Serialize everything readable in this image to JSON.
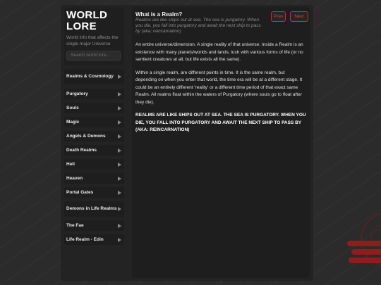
{
  "sidebar": {
    "title_line1": "WORLD",
    "title_line2": "LORE",
    "subtitle": "World info that affects the single major Universe",
    "search_placeholder": "Search world lore...",
    "items": [
      {
        "label": "Realms & Cosmology"
      },
      {
        "label": "Purgatory"
      },
      {
        "label": "Souls"
      },
      {
        "label": "Magic"
      },
      {
        "label": "Angels & Demons"
      },
      {
        "label": "Death Realms"
      },
      {
        "label": "Hell"
      },
      {
        "label": "Heaven"
      },
      {
        "label": "Portal Gates"
      },
      {
        "label": "Demons in Life Realms"
      },
      {
        "label": "The Fae"
      },
      {
        "label": "Life Realm - Edin"
      }
    ]
  },
  "article": {
    "title": "What is a Realm?",
    "subtitle": "Realms are like ships out at sea. The sea is purgatory. When you die, you fall into purgatory and await the next ship to pass by (aka: reincarnation)",
    "prev_label": "Prev",
    "next_label": "Next",
    "paragraphs": [
      "An entire universe/dimension. A single reality of that universe. Inside a Realm is an existence with many planets/worlds and lands, lush with various forms of life (or no sentient creatures at all, but life exists all the same).",
      "Within a single realm, are different points in time. It is the same realm, but depending on when you enter that world, the time era will be at a different stage. It could be an entirely different 'reality' or a different time period of that exact same Realm. All realms float within the waters of Purgatory (where souls go to float after they die).",
      "REALMS ARE LIKE SHIPS OUT AT SEA. THE SEA IS PURGATORY. WHEN YOU DIE, YOU FALL INTO PURGATORY AND AWAIT THE NEXT SHIP TO PASS BY (AKA: REINCARNATION)"
    ]
  },
  "colors": {
    "accent": "#d22a2a",
    "background": "#2b2b2b",
    "panel": "#1e1e1e"
  }
}
